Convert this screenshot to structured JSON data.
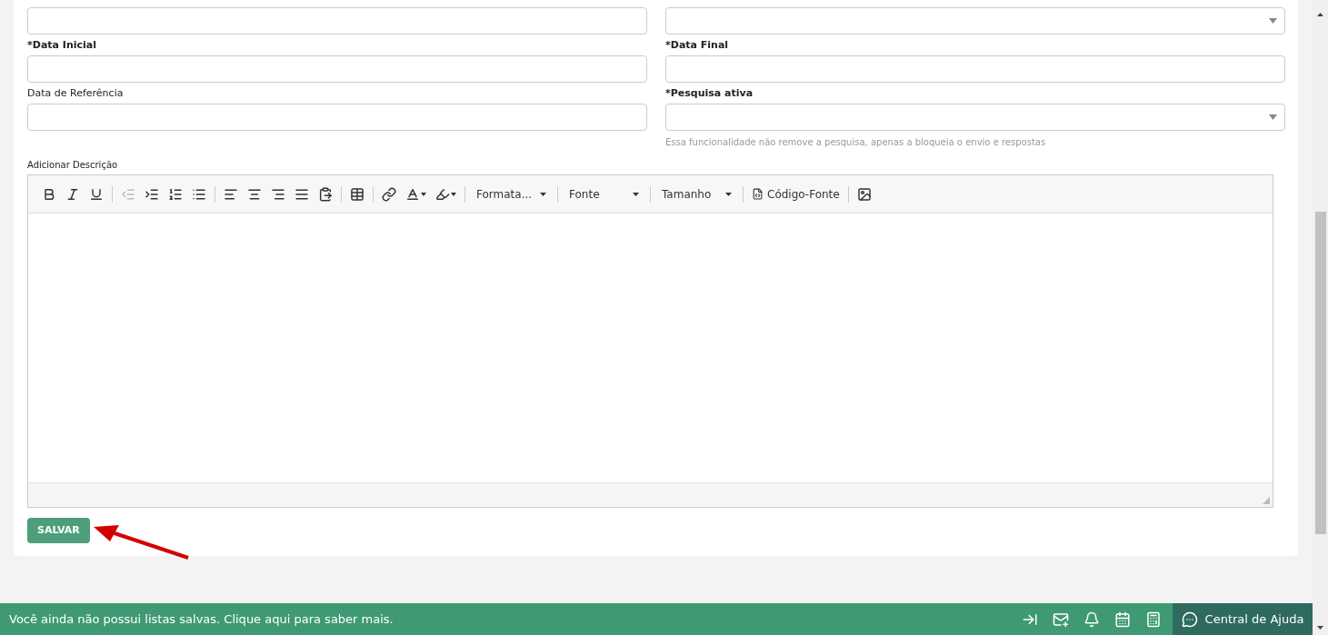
{
  "form": {
    "rows": [
      {
        "left": {
          "kind": "text"
        },
        "right": {
          "kind": "select"
        }
      },
      {
        "left": {
          "kind": "text",
          "label": "Data Inicial",
          "required": true
        },
        "right": {
          "kind": "text",
          "label": "Data Final",
          "required": true
        }
      },
      {
        "left": {
          "kind": "text",
          "label": "Data de Referência",
          "required": false
        },
        "right": {
          "kind": "select",
          "label": "Pesquisa ativa",
          "required": true,
          "hint": "Essa funcionalidade não remove a pesquisa, apenas a bloqueia o envio e respostas"
        }
      }
    ],
    "required_mark": "*",
    "description_label": "Adicionar Descrição",
    "editor": {
      "toolbar": [
        [
          {
            "kind": "icon",
            "disabled": false
          },
          {
            "kind": "icon",
            "disabled": false
          },
          {
            "kind": "icon",
            "disabled": false
          }
        ],
        [
          {
            "kind": "icon",
            "disabled": true
          },
          {
            "kind": "icon",
            "disabled": false
          },
          {
            "kind": "icon",
            "disabled": false
          },
          {
            "kind": "icon",
            "disabled": false
          }
        ],
        [
          {
            "kind": "icon",
            "disabled": false
          },
          {
            "kind": "icon",
            "disabled": false
          },
          {
            "kind": "icon",
            "disabled": false
          },
          {
            "kind": "icon",
            "disabled": false
          },
          {
            "kind": "icon",
            "disabled": false
          }
        ],
        [
          {
            "kind": "icon",
            "disabled": false
          }
        ],
        [
          {
            "kind": "icon",
            "disabled": false
          },
          {
            "kind": "color",
            "disabled": false
          },
          {
            "kind": "color",
            "disabled": false
          }
        ],
        [
          {
            "kind": "dropdown",
            "label": "Formata..."
          }
        ],
        [
          {
            "kind": "dropdown",
            "label": "Fonte"
          }
        ],
        [
          {
            "kind": "dropdown",
            "label": "Tamanho"
          }
        ],
        [
          {
            "kind": "button",
            "label": "Código-Fonte"
          }
        ],
        [
          {
            "kind": "icon",
            "disabled": false
          }
        ]
      ]
    },
    "save_button": "SALVAR"
  },
  "status_bar": {
    "message": "Você ainda não possui listas salvas. Clique aqui para saber mais.",
    "help": "Central de Ajuda"
  }
}
